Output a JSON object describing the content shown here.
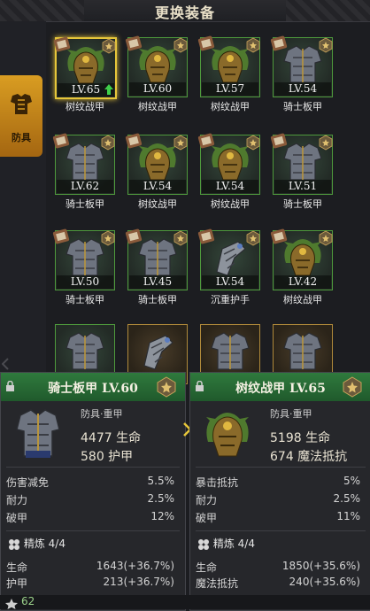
{
  "header": {
    "title": "更换装备"
  },
  "category": {
    "label": "防具",
    "icon": "armor-icon"
  },
  "items": [
    {
      "level": "LV.65",
      "name": "树纹战甲",
      "type": "helm",
      "selected": true,
      "upgrade": true
    },
    {
      "level": "LV.60",
      "name": "树纹战甲",
      "type": "helm"
    },
    {
      "level": "LV.57",
      "name": "树纹战甲",
      "type": "helm"
    },
    {
      "level": "LV.54",
      "name": "骑士板甲",
      "type": "plate"
    },
    {
      "level": "LV.62",
      "name": "骑士板甲",
      "type": "plate"
    },
    {
      "level": "LV.54",
      "name": "树纹战甲",
      "type": "helm"
    },
    {
      "level": "LV.54",
      "name": "树纹战甲",
      "type": "helm"
    },
    {
      "level": "LV.51",
      "name": "骑士板甲",
      "type": "plate"
    },
    {
      "level": "LV.50",
      "name": "骑士板甲",
      "type": "plate"
    },
    {
      "level": "LV.45",
      "name": "骑士板甲",
      "type": "plate"
    },
    {
      "level": "LV.54",
      "name": "沉重护手",
      "type": "gauntlet"
    },
    {
      "level": "LV.42",
      "name": "树纹战甲",
      "type": "helm"
    }
  ],
  "compare": {
    "left": {
      "name": "骑士板甲 LV.60",
      "subtype": "防具·重甲",
      "main1": "4477 生命",
      "main2": "580 护甲",
      "stats": [
        {
          "k": "伤害减免",
          "v": "5.5%"
        },
        {
          "k": "耐力",
          "v": "2.5%"
        },
        {
          "k": "破甲",
          "v": "12%"
        }
      ],
      "refine": "精炼 4/4",
      "substats": [
        {
          "k": "生命",
          "v": "1643(+36.7%)"
        },
        {
          "k": "护甲",
          "v": "213(+36.7%)"
        }
      ]
    },
    "right": {
      "name": "树纹战甲 LV.65",
      "subtype": "防具·重甲",
      "main1": "5198 生命",
      "main2": "674 魔法抵抗",
      "stats": [
        {
          "k": "暴击抵抗",
          "v": "5%"
        },
        {
          "k": "耐力",
          "v": "2.5%"
        },
        {
          "k": "破甲",
          "v": "11%"
        }
      ],
      "refine": "精炼 4/4",
      "substats": [
        {
          "k": "生命",
          "v": "1850(+35.6%)"
        },
        {
          "k": "魔法抵抗",
          "v": "240(+35.6%)"
        }
      ]
    }
  },
  "footer": {
    "value": "62"
  },
  "colors": {
    "accent": "#d99d22",
    "green_border": "#4e9a3c",
    "selected": "#e6c63a",
    "panel_head": "#2f7a3d"
  }
}
